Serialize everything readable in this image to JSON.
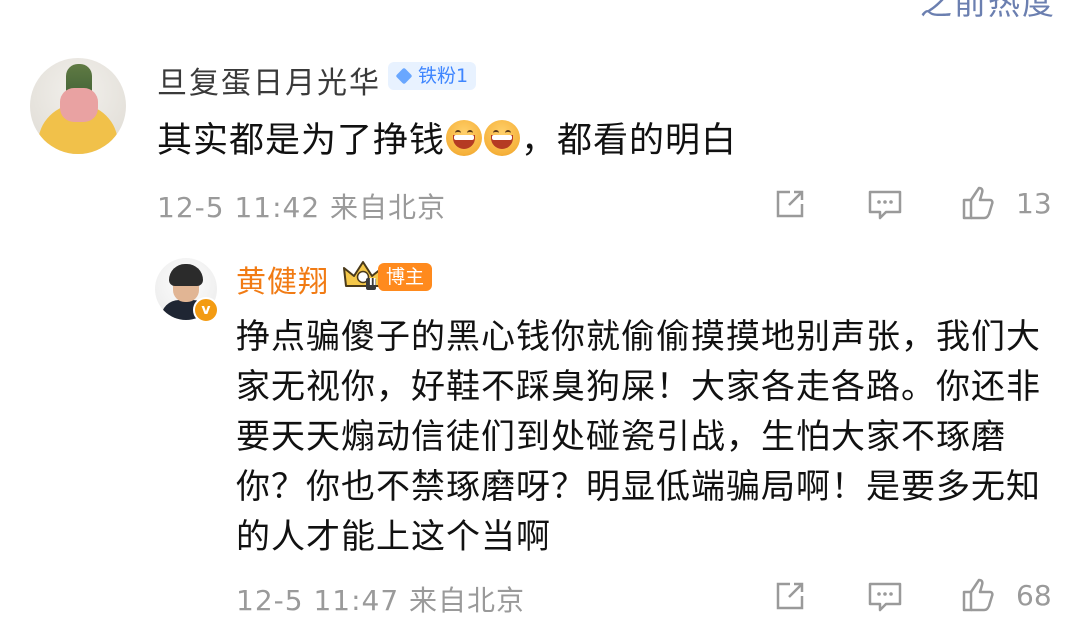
{
  "top_partial": "之前热度",
  "comment": {
    "username": "旦复蛋日月光华",
    "badge": "铁粉1",
    "text_before": "其实都是为了挣钱",
    "text_after": "，都看的明白",
    "emojis": [
      "laugh-emoji",
      "laugh-emoji"
    ],
    "meta": "12-5 11:42  来自北京",
    "like_count": "13"
  },
  "reply": {
    "username": "黄健翔",
    "verified_badge": "v",
    "level_badge": "II",
    "role_badge": "博主",
    "text": "挣点骗傻子的黑心钱你就偷偷摸摸地别声张，我们大家无视你，好鞋不踩臭狗屎！大家各走各路。你还非要天天煽动信徒们到处碰瓷引战，生怕大家不琢磨你？你也不禁琢磨呀？明显低端骗局啊！是要多无知的人才能上这个当啊",
    "meta": "12-5 11:47  来自北京",
    "like_count": "68"
  },
  "colors": {
    "name_vip": "#f17b14",
    "fan_badge_bg": "#e8f2ff",
    "fan_badge_text": "#3f86ff",
    "blogger_badge": "#ff8a1d",
    "meta_gray": "#9a9a9a"
  },
  "icons": [
    "share-icon",
    "comment-icon",
    "like-icon"
  ]
}
